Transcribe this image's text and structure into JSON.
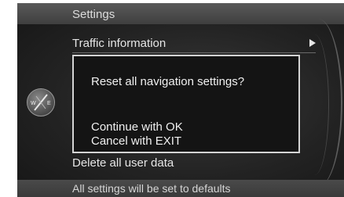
{
  "header": {
    "title": "Settings"
  },
  "menu": {
    "items": [
      {
        "label": "Traffic information"
      },
      {
        "label": "Delete all user data"
      }
    ]
  },
  "dialog": {
    "question": "Reset all navigation settings?",
    "option_ok": "Continue with OK",
    "option_exit": "Cancel with EXIT"
  },
  "status": {
    "text": "All settings will be set to defaults"
  },
  "compass": {
    "letters": [
      "W",
      "E"
    ]
  },
  "colors": {
    "background": "#232323",
    "text": "#e6e6e6",
    "dialog_border": "#d4d4d4"
  }
}
